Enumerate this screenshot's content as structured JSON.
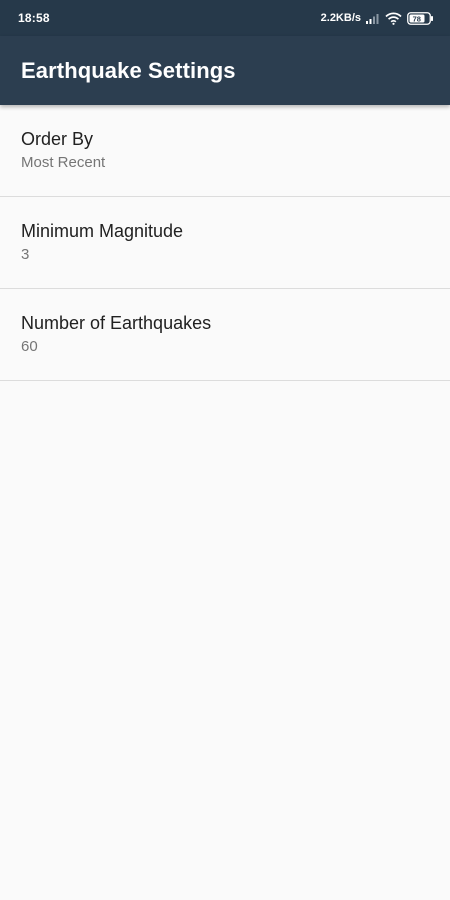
{
  "status_bar": {
    "time": "18:58",
    "net_speed": "2.2KB/s",
    "battery_level": "78",
    "icons": [
      "signal-icon",
      "wifi-icon",
      "battery-icon"
    ]
  },
  "app_bar": {
    "title": "Earthquake Settings",
    "color": "#2c3e50"
  },
  "preferences": [
    {
      "title": "Order By",
      "summary": "Most Recent"
    },
    {
      "title": "Minimum Magnitude",
      "summary": "3"
    },
    {
      "title": "Number of Earthquakes",
      "summary": "60"
    }
  ]
}
